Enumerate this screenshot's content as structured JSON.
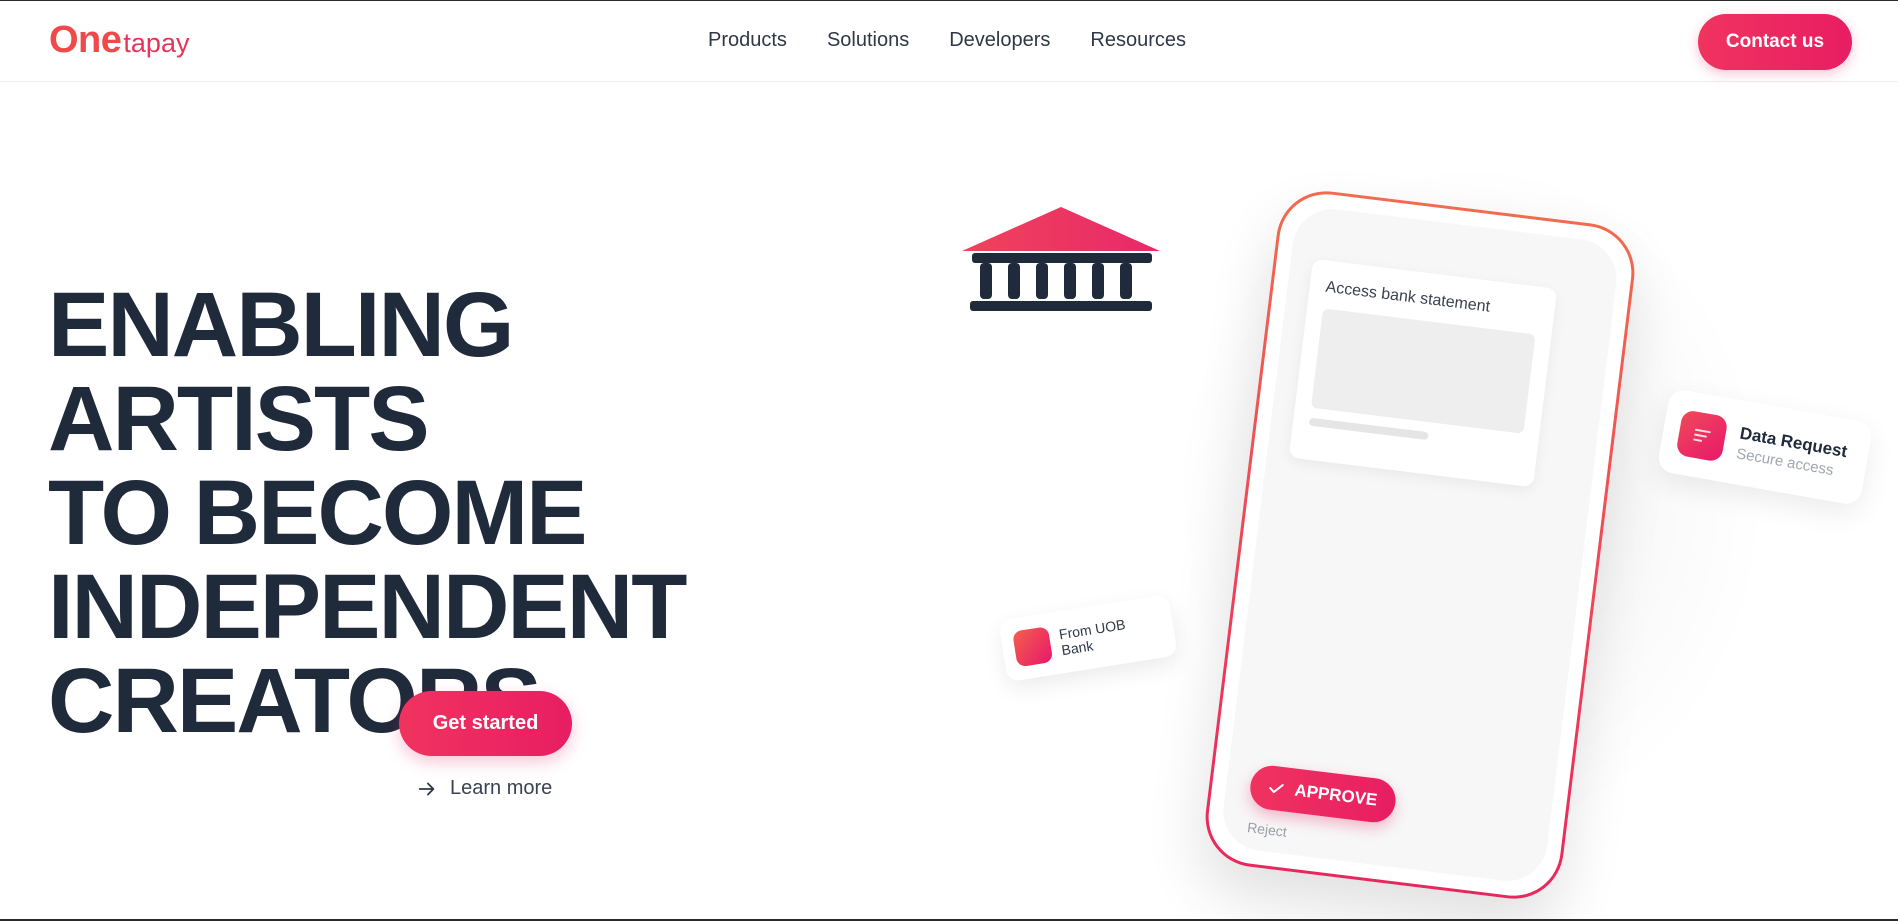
{
  "brand": {
    "logo_main": "One",
    "logo_suffix": "tapay",
    "primary_color": "#f0335f",
    "accent_color": "#e81d63",
    "text_color": "#1f2a3b"
  },
  "nav": {
    "items": [
      "Products",
      "Solutions",
      "Developers",
      "Resources"
    ],
    "contact_label": "Contact us"
  },
  "hero": {
    "title_lines": [
      "ENABLING ARTISTS",
      "TO BECOME",
      "INDEPENDENT",
      "CREATORS"
    ],
    "cta_label": "Get started",
    "secondary_label": "Learn more",
    "secondary_icon": "arrow-right-icon"
  },
  "illustration": {
    "bank_icon": "bank-icon",
    "phone": {
      "card_title": "Access bank statement",
      "approve_label": "APPROVE",
      "approve_icon": "check-icon",
      "reject_label": "Reject"
    },
    "data_request": {
      "title": "Data Request",
      "subtitle": "Secure access",
      "icon": "document-lines-icon"
    },
    "uob_card": {
      "label": "From UOB Bank",
      "icon": "bank-square-icon"
    }
  }
}
